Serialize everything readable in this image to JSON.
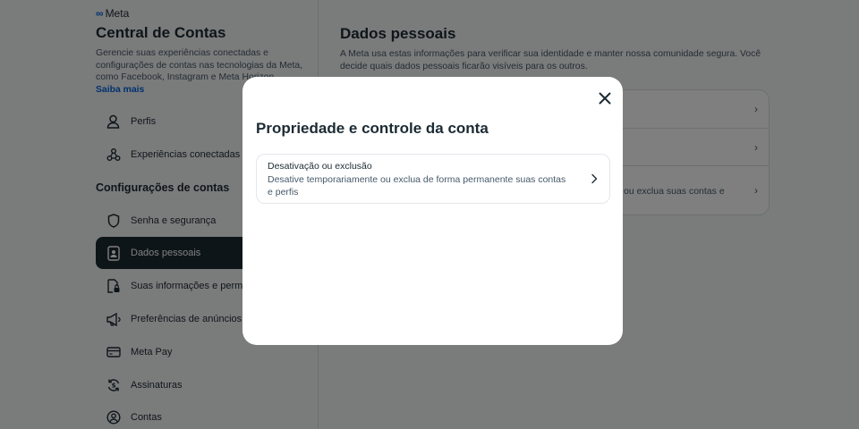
{
  "sidebar": {
    "logo_text": "Meta",
    "title": "Central de Contas",
    "description": "Gerencie suas experiências conectadas e configurações de contas nas tecnologias da Meta, como Facebook, Instagram e Meta Horizon.",
    "learn_more": "Saiba mais",
    "items_top": [
      {
        "label": "Perfis",
        "icon": "person-icon"
      },
      {
        "label": "Experiências conectadas",
        "icon": "connected-icon"
      }
    ],
    "section_label": "Configurações de contas",
    "items": [
      {
        "label": "Senha e segurança",
        "icon": "shield-icon"
      },
      {
        "label": "Dados pessoais",
        "icon": "id-card-icon",
        "active": true
      },
      {
        "label": "Suas informações e permissões",
        "icon": "lock-doc-icon"
      },
      {
        "label": "Preferências de anúncios",
        "icon": "megaphone-icon"
      },
      {
        "label": "Meta Pay",
        "icon": "card-icon"
      },
      {
        "label": "Assinaturas",
        "icon": "subscription-icon"
      },
      {
        "label": "Contas",
        "icon": "account-circle-icon"
      }
    ]
  },
  "main": {
    "title": "Dados pessoais",
    "description": "A Meta usa estas informações para verificar sua identidade e manter nossa comunidade segura. Você decide quais dados pessoais ficarão visíveis para os outros.",
    "partial_row_text": "ou exclua suas contas e"
  },
  "modal": {
    "title": "Propriedade e controle da conta",
    "option": {
      "title": "Desativação ou exclusão",
      "description": "Desative temporariamente ou exclua de forma permanente suas contas e perfis"
    }
  },
  "colors": {
    "accent": "#0064e0",
    "text": "#1c2b33",
    "secondary_text": "#465a69",
    "active_bg": "#1c2b33"
  }
}
